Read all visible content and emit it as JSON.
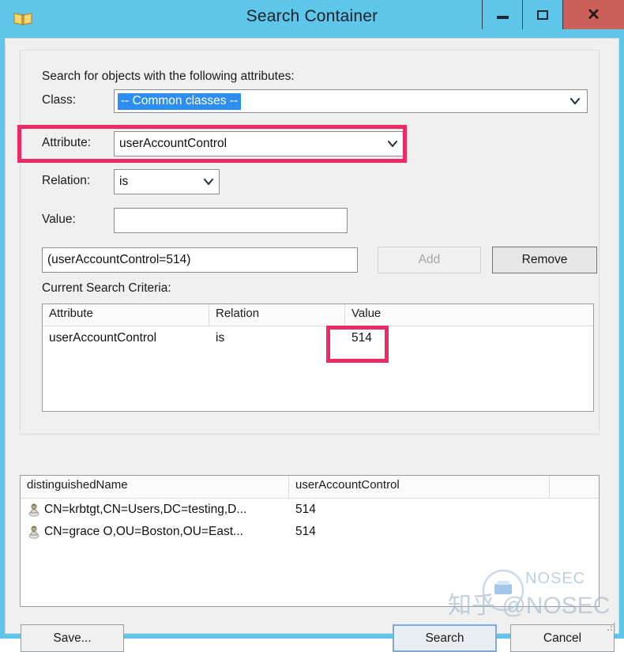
{
  "window": {
    "title": "Search Container",
    "icon": "book-icon",
    "accent_color": "#5ec6e8",
    "close_color": "#cc5f5a",
    "controls": {
      "minimize": "minimize-icon",
      "maximize": "maximize-icon",
      "close": "close-icon"
    }
  },
  "form": {
    "prompt": "Search for objects with the following attributes:",
    "class": {
      "label": "Class:",
      "value": "-- Common classes --"
    },
    "attribute": {
      "label": "Attribute:",
      "value": "userAccountControl"
    },
    "relation": {
      "label": "Relation:",
      "value": "is"
    },
    "value": {
      "label": "Value:",
      "value": "",
      "placeholder": ""
    },
    "expression": "(userAccountControl=514)",
    "add_button": "Add",
    "remove_button": "Remove",
    "criteria_label": "Current Search Criteria:"
  },
  "criteria_table": {
    "columns": [
      "Attribute",
      "Relation",
      "Value"
    ],
    "rows": [
      {
        "attribute": "userAccountControl",
        "relation": "is",
        "value": "514"
      }
    ]
  },
  "results_table": {
    "columns": [
      "distinguishedName",
      "userAccountControl",
      ""
    ],
    "rows": [
      {
        "icon": "user-icon",
        "distinguishedName": "CN=krbtgt,CN=Users,DC=testing,D...",
        "userAccountControl": "514"
      },
      {
        "icon": "user-icon",
        "distinguishedName": "CN=grace O,OU=Boston,OU=East...",
        "userAccountControl": "514"
      }
    ]
  },
  "footer": {
    "save_button": "Save...",
    "search_button": "Search",
    "secondary_button": "Cancel"
  },
  "annotations": {
    "highlight_color": "#ec2a63",
    "boxes": [
      "attribute-row",
      "criteria-value-cell"
    ]
  },
  "watermark": {
    "handle": "知乎 @NOSEC",
    "brand": "NOSEC"
  }
}
